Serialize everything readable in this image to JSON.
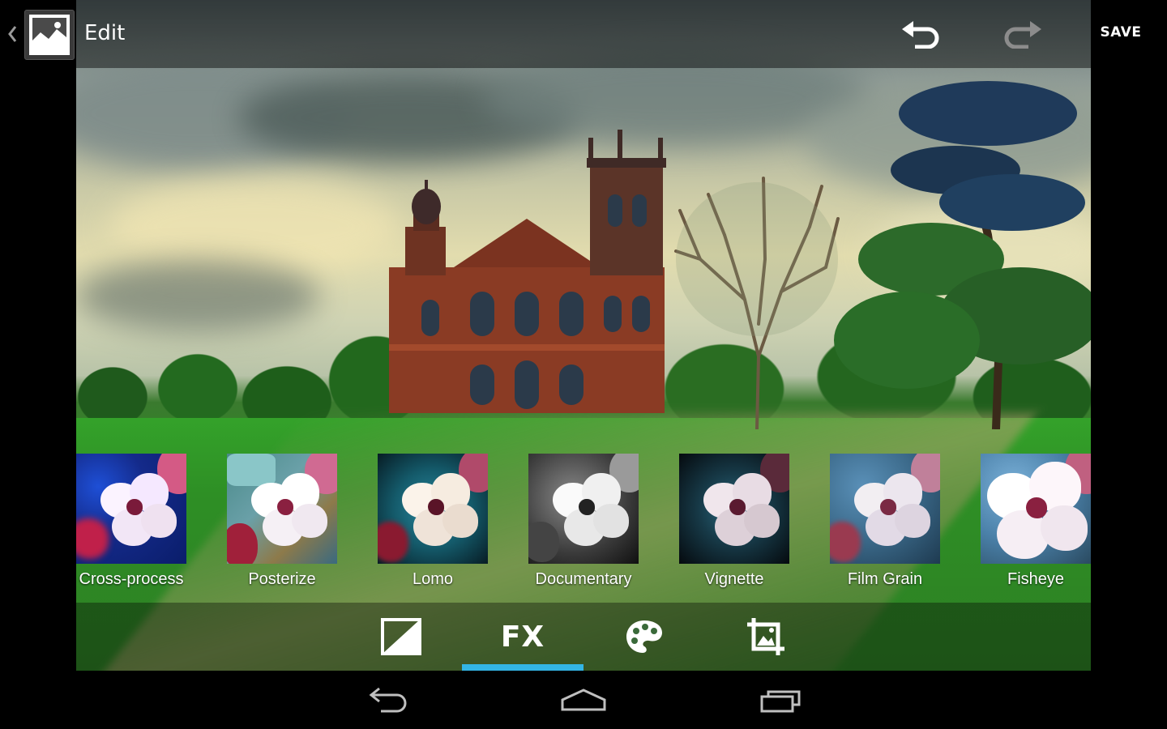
{
  "actionbar": {
    "title": "Edit",
    "save_label": "SAVE",
    "icons": {
      "up": "chevron-left-icon",
      "app": "gallery-icon",
      "undo": "undo-icon",
      "redo": "redo-icon"
    }
  },
  "filters": [
    {
      "label": "Cross-process",
      "style": "cross-process"
    },
    {
      "label": "Posterize",
      "style": "posterize"
    },
    {
      "label": "Lomo",
      "style": "lomo"
    },
    {
      "label": "Documentary",
      "style": "documentary"
    },
    {
      "label": "Vignette",
      "style": "vignette"
    },
    {
      "label": "Film Grain",
      "style": "film-grain"
    },
    {
      "label": "Fisheye",
      "style": "fisheye"
    }
  ],
  "toolbar": {
    "tools": [
      {
        "name": "tone",
        "icon": "brightness-contrast-icon"
      },
      {
        "name": "fx",
        "label": "FX",
        "active": true
      },
      {
        "name": "color",
        "icon": "palette-icon"
      },
      {
        "name": "crop",
        "icon": "crop-icon"
      }
    ],
    "accent_color": "#33b5e5"
  },
  "navbar": {
    "icons": [
      "back-icon",
      "home-icon",
      "recent-apps-icon"
    ]
  }
}
